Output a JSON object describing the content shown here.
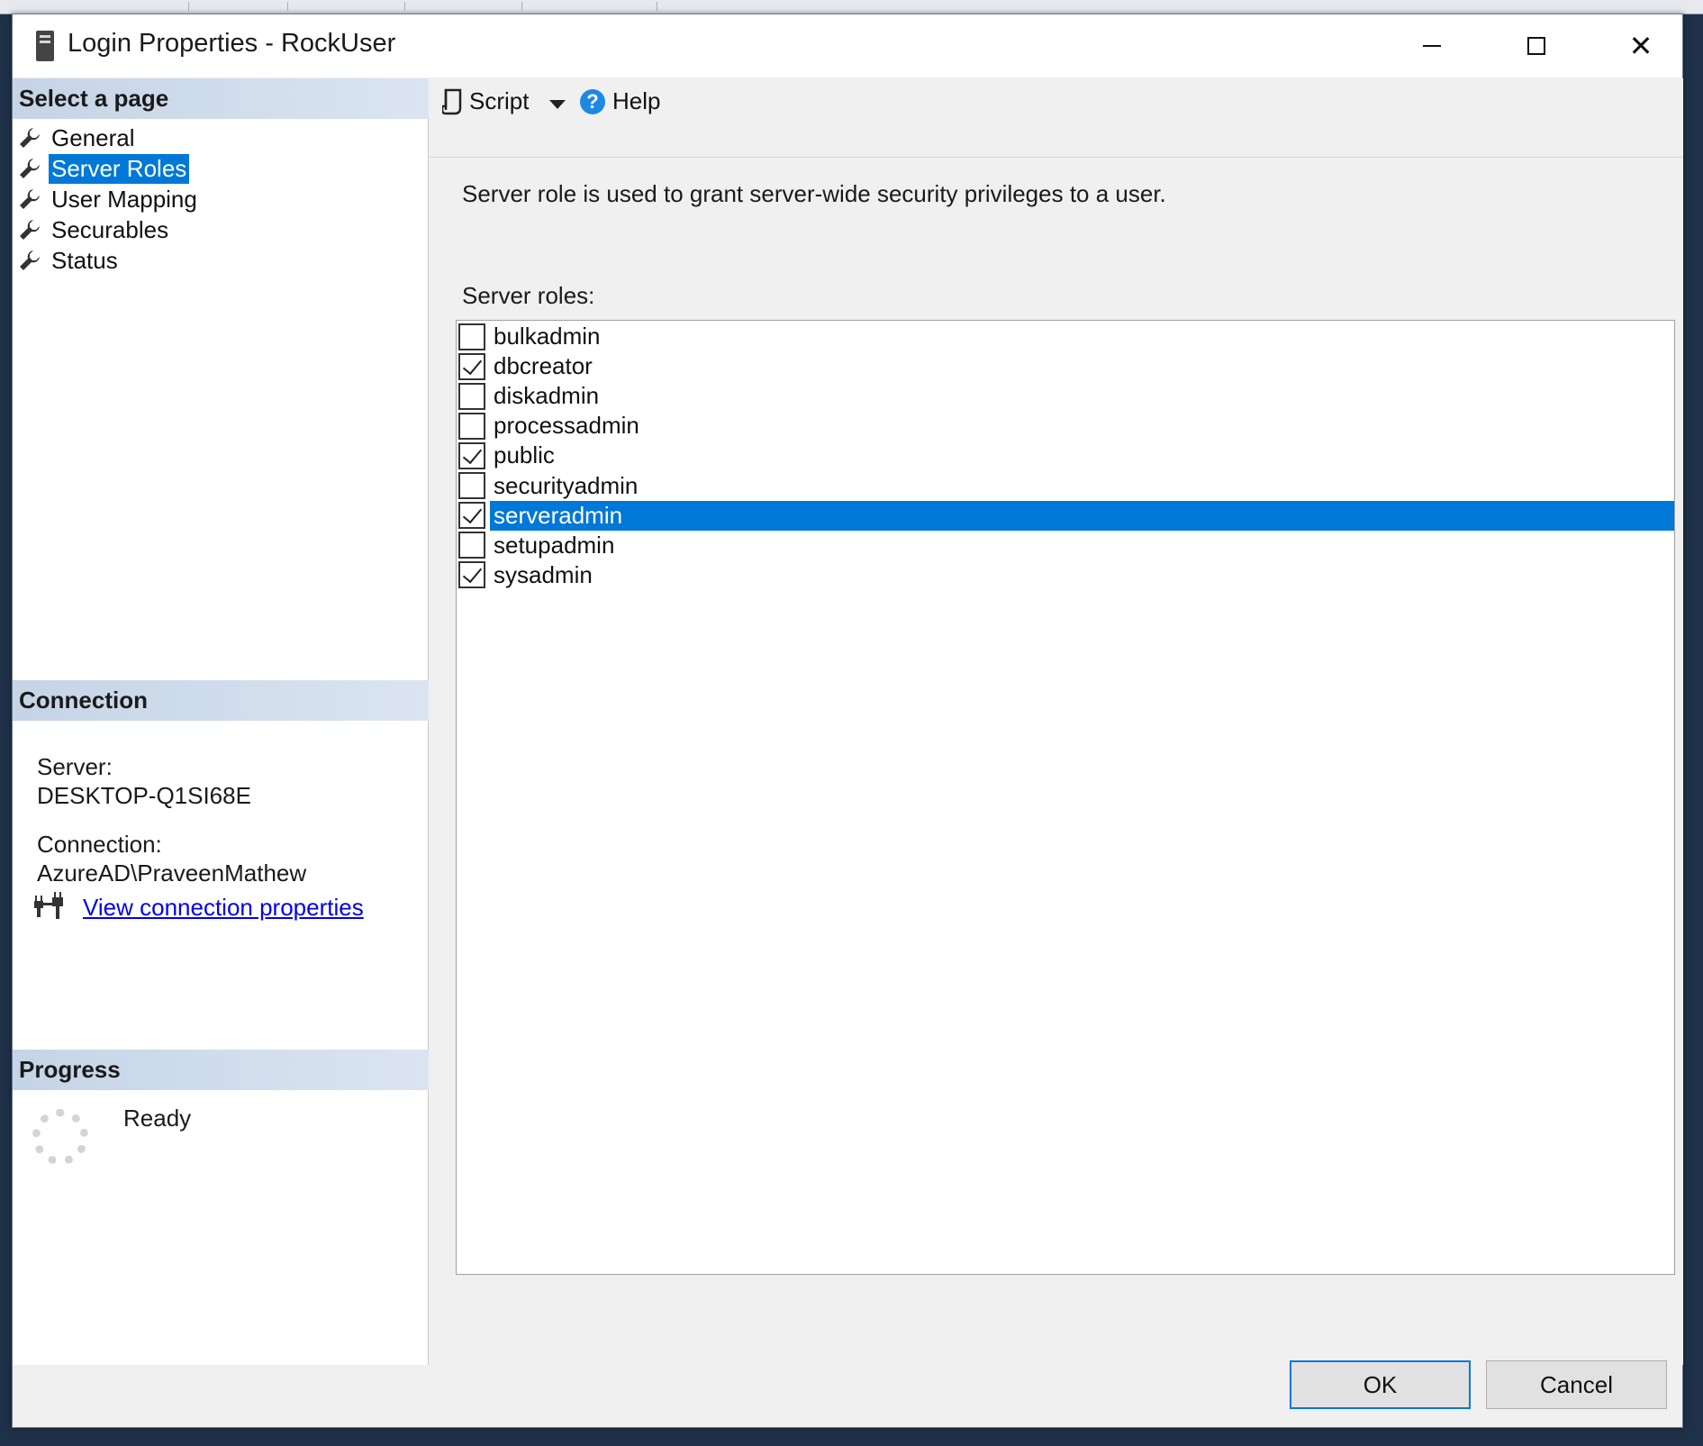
{
  "window": {
    "title": "Login Properties - RockUser"
  },
  "left": {
    "select_page_header": "Select a page",
    "pages": [
      {
        "label": "General"
      },
      {
        "label": "Server Roles"
      },
      {
        "label": "User Mapping"
      },
      {
        "label": "Securables"
      },
      {
        "label": "Status"
      }
    ],
    "selected_page": "Server Roles",
    "connection_header": "Connection",
    "server_label": "Server:",
    "server_value": "DESKTOP-Q1SI68E",
    "connection_label": "Connection:",
    "connection_value": "AzureAD\\PraveenMathew",
    "view_connection_link": "View connection properties",
    "progress_header": "Progress",
    "progress_status": "Ready"
  },
  "toolbar": {
    "script_label": "Script",
    "help_label": "Help"
  },
  "main": {
    "description": "Server role is used to grant server-wide security privileges to a user.",
    "roles_label": "Server roles:",
    "roles": [
      {
        "name": "bulkadmin",
        "checked": false
      },
      {
        "name": "dbcreator",
        "checked": true
      },
      {
        "name": "diskadmin",
        "checked": false
      },
      {
        "name": "processadmin",
        "checked": false
      },
      {
        "name": "public",
        "checked": true
      },
      {
        "name": "securityadmin",
        "checked": false
      },
      {
        "name": "serveradmin",
        "checked": true
      },
      {
        "name": "setupadmin",
        "checked": false
      },
      {
        "name": "sysadmin",
        "checked": true
      }
    ],
    "selected_role": "serveradmin"
  },
  "buttons": {
    "ok_label": "OK",
    "cancel_label": "Cancel"
  },
  "colors": {
    "selection": "#0078d7",
    "section_header": "#c5d4e6",
    "link": "#0000ee"
  }
}
